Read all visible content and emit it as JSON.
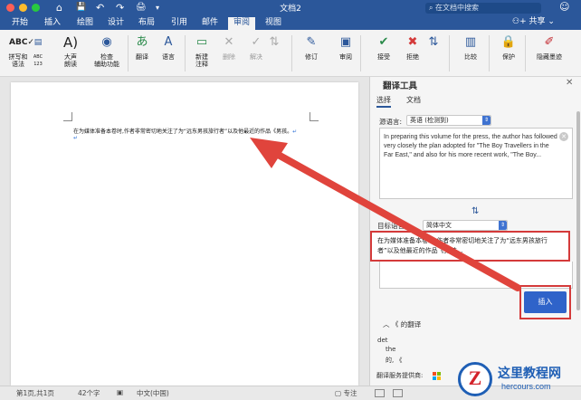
{
  "titlebar": {
    "title": "文档2",
    "search_placeholder": "在文档中搜索",
    "quick_access": [
      "⌂",
      "💾",
      "↶",
      "↷",
      "🖨",
      "▾"
    ]
  },
  "tabs": {
    "items": [
      "开始",
      "插入",
      "绘图",
      "设计",
      "布局",
      "引用",
      "邮件",
      "审阅",
      "视图"
    ],
    "active": "审阅",
    "share_label": "共享"
  },
  "ribbon": {
    "buttons": [
      {
        "label": "拼写和\n语法",
        "icon": "spellcheck-icon"
      },
      {
        "label": "ABC\n123",
        "icon": "word-count-icon"
      },
      {
        "label": "大声\n朗读",
        "icon": "read-aloud-icon"
      },
      {
        "label": "检查\n辅助功能",
        "icon": "accessibility-icon"
      },
      {
        "label": "翻译",
        "icon": "translate-icon"
      },
      {
        "label": "语言",
        "icon": "language-icon"
      },
      {
        "label": "新建\n注释",
        "icon": "new-comment-icon"
      },
      {
        "label": "删除",
        "icon": "delete-comment-icon"
      },
      {
        "label": "解决",
        "icon": "resolve-icon"
      },
      {
        "label": "修订",
        "icon": "track-changes-icon"
      },
      {
        "label": "审阅",
        "icon": "review-pane-icon"
      },
      {
        "label": "接受",
        "icon": "accept-icon"
      },
      {
        "label": "拒绝",
        "icon": "reject-icon"
      },
      {
        "label": "比较",
        "icon": "compare-icon"
      },
      {
        "label": "保护",
        "icon": "protect-icon"
      },
      {
        "label": "隐藏墨迹",
        "icon": "hide-ink-icon"
      }
    ]
  },
  "document": {
    "text": "在为媒体准备本卷时,作者非常密切地关注了为“远东男孩旅行者”以及他最近的作品《男孩。"
  },
  "panel": {
    "title": "翻译工具",
    "tabs": [
      "选择",
      "文档"
    ],
    "active_tab": "选择",
    "source_label": "源语言:",
    "source_language": "英语 (检测到)",
    "source_text": "In preparing this volume for the press, the author has followed very closely the plan adopted for \"The Boy Travellers in the Far East,\" and also for his more recent work, \"The Boy...",
    "target_label": "目标语言:",
    "target_language": "简体中文",
    "target_text": "在为媒体准备本卷时,作者非常密切地关注了为“远东男孩旅行者”以及他最近的作品《男孩...",
    "insert_label": "插入",
    "dict_heading": "《 的翻译",
    "dict_words": [
      "det",
      "the",
      "的, 《"
    ],
    "provider_label": "翻译服务提供商:"
  },
  "statusbar": {
    "page": "第1页,共1页",
    "words": "42个字",
    "language": "中文(中国)",
    "focus": "专注"
  },
  "watermark": {
    "name": "这里教程网",
    "url": "hercours.com",
    "letter": "Z"
  },
  "colors": {
    "brand": "#2b579a",
    "highlight_red": "#d43a3a",
    "insert_blue": "#2f63c9"
  }
}
